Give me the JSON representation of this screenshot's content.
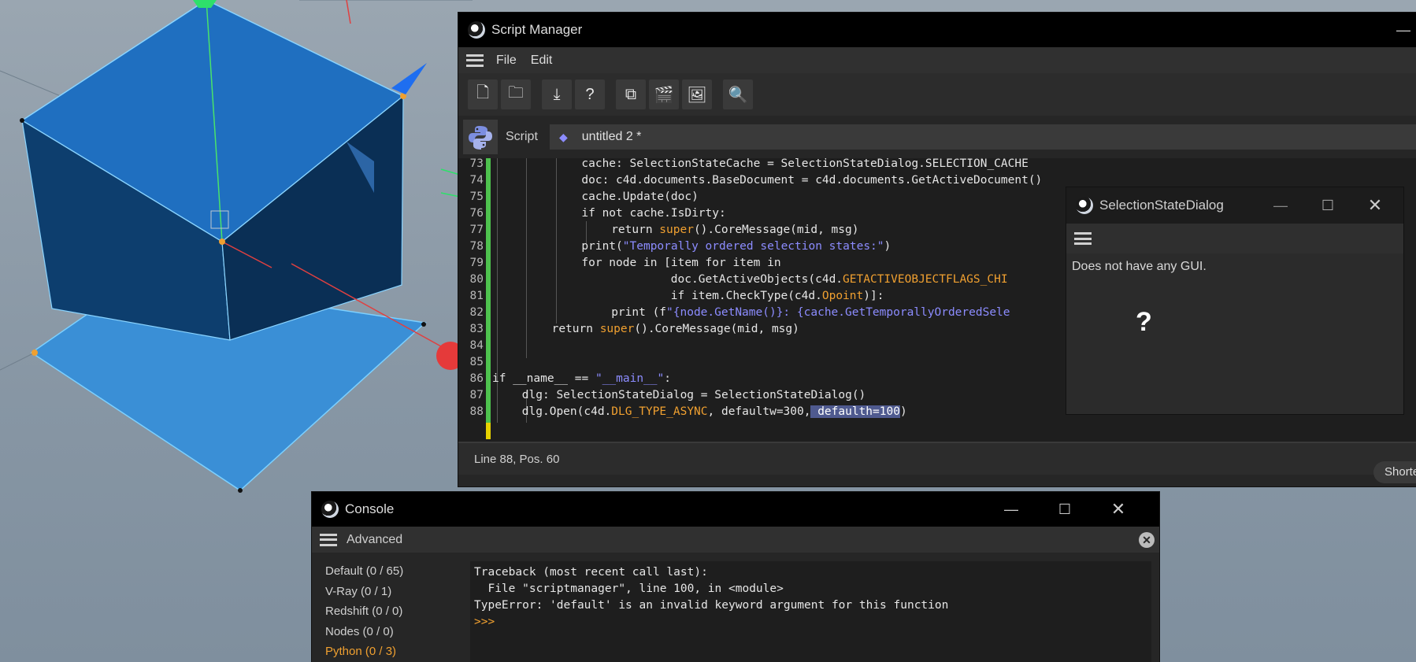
{
  "script_manager": {
    "title": "Script Manager",
    "menu": [
      "File",
      "Edit"
    ],
    "tab_label": "Script",
    "script_name": "untitled 2 *",
    "status": "Line 88, Pos. 60",
    "shortcut_button": "Shorte",
    "code_lines": [
      {
        "num": "73",
        "indent": 3,
        "parts": [
          [
            "cache: SelectionStateCache = SelectionStateDialog.SELECTION_CACHE",
            ""
          ]
        ]
      },
      {
        "num": "74",
        "indent": 3,
        "parts": [
          [
            "doc: c4d.documents.BaseDocument = c4d.documents.GetActiveDocument()",
            ""
          ]
        ]
      },
      {
        "num": "75",
        "indent": 3,
        "parts": [
          [
            "cache.Update(doc)",
            ""
          ]
        ]
      },
      {
        "num": "76",
        "indent": 3,
        "parts": [
          [
            "if not cache.IsDirty:",
            ""
          ]
        ]
      },
      {
        "num": "77",
        "indent": 4,
        "parts": [
          [
            "return ",
            ""
          ],
          [
            "super",
            "kw-or"
          ],
          [
            "().CoreMessage(mid, msg)",
            ""
          ]
        ]
      },
      {
        "num": "78",
        "indent": 3,
        "parts": [
          [
            "print(",
            ""
          ],
          [
            "\"Temporally ordered selection states:\"",
            "kw-bl"
          ],
          [
            ")",
            ""
          ]
        ]
      },
      {
        "num": "79",
        "indent": 3,
        "parts": [
          [
            "for node in [item for item in",
            ""
          ]
        ]
      },
      {
        "num": "80",
        "indent": 6,
        "parts": [
          [
            "doc.GetActiveObjects(c4d.",
            ""
          ],
          [
            "GETACTIVEOBJECTFLAGS_CHI",
            "kw-or"
          ]
        ]
      },
      {
        "num": "81",
        "indent": 6,
        "parts": [
          [
            "if item.CheckType(c4d.",
            ""
          ],
          [
            "Opoint",
            "kw-or"
          ],
          [
            ")]:",
            ""
          ]
        ]
      },
      {
        "num": "82",
        "indent": 4,
        "parts": [
          [
            "print (f",
            ""
          ],
          [
            "\"{node.GetName()}: {cache.GetTemporallyOrderedSele",
            "kw-bl"
          ]
        ]
      },
      {
        "num": "83",
        "indent": 2,
        "parts": [
          [
            "return ",
            ""
          ],
          [
            "super",
            "kw-or"
          ],
          [
            "().CoreMessage(mid, msg)",
            ""
          ]
        ]
      },
      {
        "num": "84",
        "indent": 0,
        "parts": [
          [
            "",
            ""
          ]
        ]
      },
      {
        "num": "85",
        "indent": 0,
        "parts": [
          [
            "",
            ""
          ]
        ]
      },
      {
        "num": "86",
        "indent": 0,
        "parts": [
          [
            "if __name__ == ",
            ""
          ],
          [
            "\"__main__\"",
            "kw-bl"
          ],
          [
            ":",
            ""
          ]
        ]
      },
      {
        "num": "87",
        "indent": 1,
        "parts": [
          [
            "dlg: SelectionStateDialog = SelectionStateDialog()",
            ""
          ]
        ]
      },
      {
        "num": "88",
        "indent": 1,
        "parts": [
          [
            "dlg.Open(c4d.",
            ""
          ],
          [
            "DLG_TYPE_ASYNC",
            "kw-or"
          ],
          [
            ", defaultw=300,",
            ""
          ],
          [
            " defaulth=100",
            "sel"
          ],
          [
            ")",
            ""
          ]
        ]
      }
    ]
  },
  "selection_dialog": {
    "title": "SelectionStateDialog",
    "message": "Does not have any GUI.",
    "help_glyph": "?"
  },
  "console": {
    "title": "Console",
    "menu_label": "Advanced",
    "channels": [
      {
        "label": "Default (0 / 65)",
        "active": false
      },
      {
        "label": "V-Ray (0 / 1)",
        "active": false
      },
      {
        "label": "Redshift (0 / 0)",
        "active": false
      },
      {
        "label": "Nodes (0 / 0)",
        "active": false
      },
      {
        "label": "Python (0 / 3)",
        "active": true
      }
    ],
    "output_lines": [
      {
        "text": "Traceback (most recent call last):",
        "cls": ""
      },
      {
        "text": "  File \"scriptmanager\", line 100, in <module>",
        "cls": ""
      },
      {
        "text": "TypeError: 'default' is an invalid keyword argument for this function",
        "cls": ""
      },
      {
        "text": ">>>",
        "cls": "kw-or"
      }
    ]
  },
  "colors": {
    "accent_orange": "#f0a030",
    "string_blue": "#8c8cff",
    "selection": "#4f5a8f",
    "gutter_green": "#4ec24e",
    "gutter_yellow": "#e6d200"
  }
}
